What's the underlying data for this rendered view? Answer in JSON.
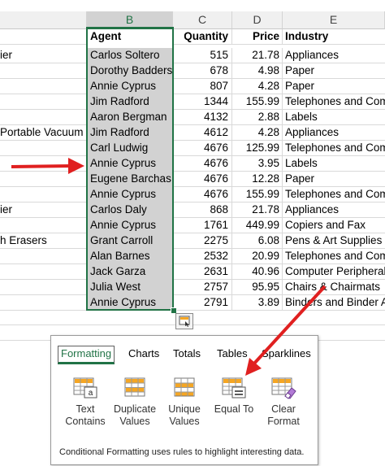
{
  "columns": {
    "b": "B",
    "c": "C",
    "d": "D",
    "e": "E"
  },
  "header": {
    "agent": "Agent",
    "quantity": "Quantity",
    "price": "Price",
    "industry": "Industry"
  },
  "rows": [
    {
      "a": "ier",
      "agent": "Carlos Soltero",
      "quantity": "515",
      "price": "21.78",
      "industry": "Appliances"
    },
    {
      "a": "",
      "agent": "Dorothy Badders",
      "quantity": "678",
      "price": "4.98",
      "industry": "Paper"
    },
    {
      "a": "",
      "agent": "Annie Cyprus",
      "quantity": "807",
      "price": "4.28",
      "industry": "Paper"
    },
    {
      "a": "",
      "agent": "Jim Radford",
      "quantity": "1344",
      "price": "155.99",
      "industry": "Telephones and Comm"
    },
    {
      "a": "",
      "agent": "Aaron Bergman",
      "quantity": "4132",
      "price": "2.88",
      "industry": "Labels"
    },
    {
      "a": "Portable Vacuum",
      "agent": "Jim Radford",
      "quantity": "4612",
      "price": "4.28",
      "industry": "Appliances"
    },
    {
      "a": "",
      "agent": "Carl Ludwig",
      "quantity": "4676",
      "price": "125.99",
      "industry": "Telephones and Comm"
    },
    {
      "a": "",
      "agent": "Annie Cyprus",
      "quantity": "4676",
      "price": "3.95",
      "industry": "Labels"
    },
    {
      "a": "",
      "agent": "Eugene Barchas",
      "quantity": "4676",
      "price": "12.28",
      "industry": "Paper"
    },
    {
      "a": "",
      "agent": "Annie Cyprus",
      "quantity": "4676",
      "price": "155.99",
      "industry": "Telephones and Comm"
    },
    {
      "a": "ier",
      "agent": "Carlos Daly",
      "quantity": "868",
      "price": "21.78",
      "industry": "Appliances"
    },
    {
      "a": "",
      "agent": "Annie Cyprus",
      "quantity": "1761",
      "price": "449.99",
      "industry": "Copiers and Fax"
    },
    {
      "a": "h Erasers",
      "agent": "Grant Carroll",
      "quantity": "2275",
      "price": "6.08",
      "industry": "Pens & Art Supplies"
    },
    {
      "a": "",
      "agent": "Alan Barnes",
      "quantity": "2532",
      "price": "20.99",
      "industry": "Telephones and Comm"
    },
    {
      "a": "",
      "agent": "Jack Garza",
      "quantity": "2631",
      "price": "40.96",
      "industry": "Computer Peripherals"
    },
    {
      "a": "",
      "agent": "Julia West",
      "quantity": "2757",
      "price": "95.95",
      "industry": "Chairs & Chairmats"
    },
    {
      "a": "",
      "agent": "Annie Cyprus",
      "quantity": "2791",
      "price": "3.89",
      "industry": "Binders and Binder Ac"
    }
  ],
  "quick_analysis": {
    "tabs": [
      "Formatting",
      "Charts",
      "Totals",
      "Tables",
      "Sparklines"
    ],
    "active_tab": "Formatting",
    "tools": [
      {
        "label1": "Text",
        "label2": "Contains",
        "icon": "text-contains-icon"
      },
      {
        "label1": "Duplicate",
        "label2": "Values",
        "icon": "duplicate-values-icon"
      },
      {
        "label1": "Unique",
        "label2": "Values",
        "icon": "unique-values-icon"
      },
      {
        "label1": "Equal To",
        "label2": "",
        "icon": "equal-to-icon"
      },
      {
        "label1": "Clear",
        "label2": "Format",
        "icon": "clear-format-icon"
      }
    ],
    "description": "Conditional Formatting uses rules to highlight interesting data."
  },
  "colors": {
    "excel_green": "#217346",
    "selection_gray": "#d2d2d2",
    "arrow_red": "#e02020",
    "highlight_orange": "#f5a623"
  }
}
